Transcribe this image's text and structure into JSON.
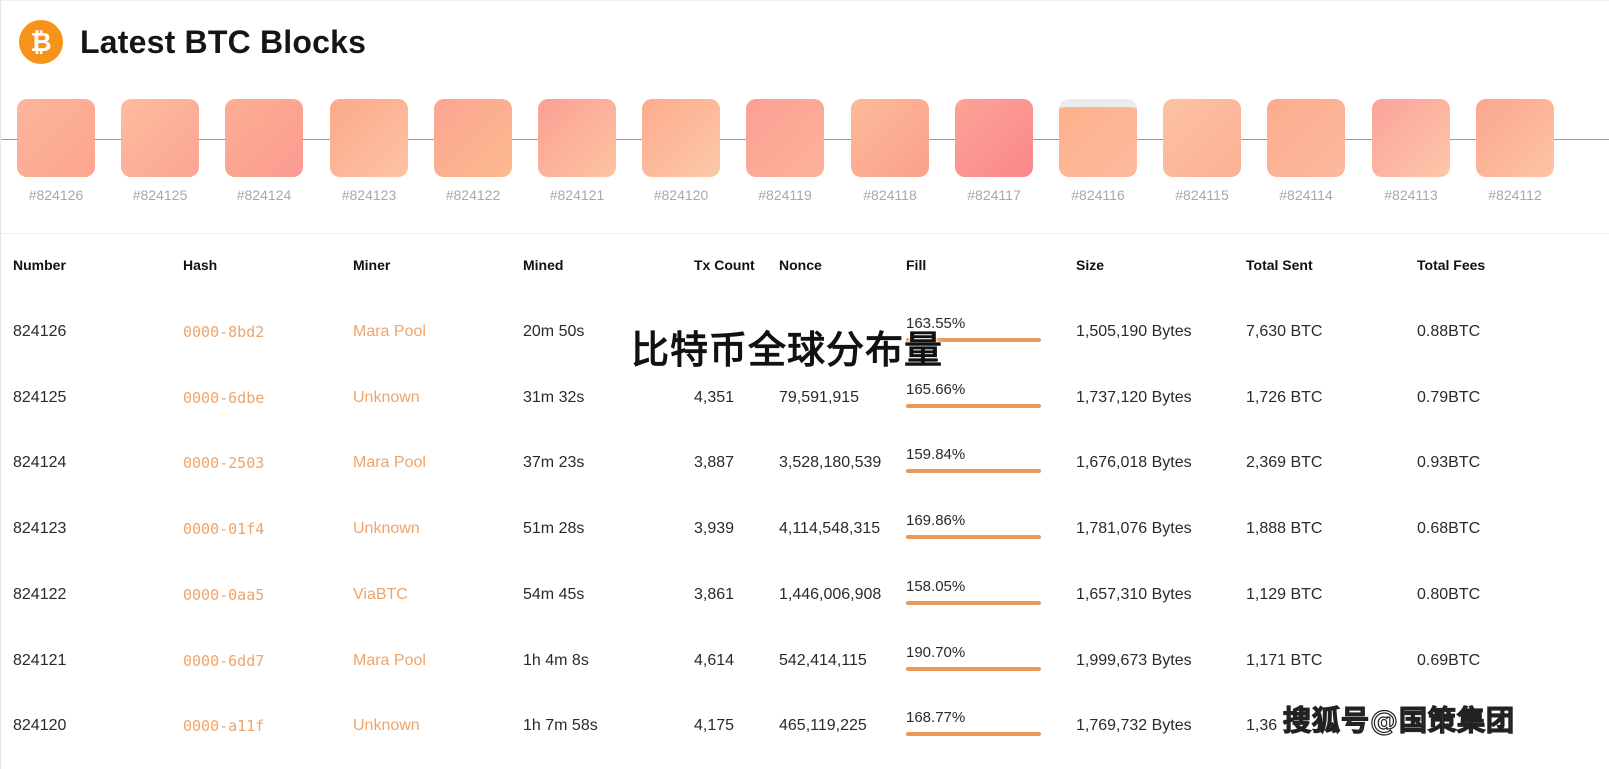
{
  "header": {
    "logo_glyph": "₿",
    "title": "Latest BTC Blocks"
  },
  "blocks": [
    {
      "label": "#824126",
      "color_a": "#fcb59b",
      "color_b": "#fda58f"
    },
    {
      "label": "#824125",
      "color_a": "#fdbc9f",
      "color_b": "#fca493"
    },
    {
      "label": "#824124",
      "color_a": "#fcae93",
      "color_b": "#fb9b92"
    },
    {
      "label": "#824123",
      "color_a": "#fca98a",
      "color_b": "#fdc3a4"
    },
    {
      "label": "#824122",
      "color_a": "#fba593",
      "color_b": "#fdb98c"
    },
    {
      "label": "#824121",
      "color_a": "#fb9f95",
      "color_b": "#fdc4a0"
    },
    {
      "label": "#824120",
      "color_a": "#fdab8c",
      "color_b": "#fcc9aa"
    },
    {
      "label": "#824119",
      "color_a": "#fc9f95",
      "color_b": "#fdb299"
    },
    {
      "label": "#824118",
      "color_a": "#fcba9a",
      "color_b": "#fba08a"
    },
    {
      "label": "#824117",
      "color_a": "#fca397",
      "color_b": "#fb878a"
    },
    {
      "label": "#824116",
      "color_a": "#fdb08c",
      "color_b": "#fdbb9e"
    },
    {
      "label": "#824115",
      "color_a": "#fdc2a1",
      "color_b": "#fcb094"
    },
    {
      "label": "#824114",
      "color_a": "#fcac8d",
      "color_b": "#fcb89f"
    },
    {
      "label": "#824113",
      "color_a": "#fba29a",
      "color_b": "#fdc7aa"
    },
    {
      "label": "#824112",
      "color_a": "#fca68d",
      "color_b": "#fcc4a5"
    }
  ],
  "table": {
    "headers": [
      "Number",
      "Hash",
      "Miner",
      "Mined",
      "Tx Count",
      "Nonce",
      "Fill",
      "Size",
      "Total Sent",
      "Total Fees"
    ],
    "rows": [
      {
        "number": "824126",
        "hash": "0000-8bd2",
        "miner": "Mara Pool",
        "mined": "20m 50s",
        "tx_count": "",
        "nonce": "",
        "fill": "163.55%",
        "fill_value": 1.0,
        "size": "1,505,190 Bytes",
        "total_sent": "7,630 BTC",
        "total_fees": "0.88BTC"
      },
      {
        "number": "824125",
        "hash": "0000-6dbe",
        "miner": "Unknown",
        "mined": "31m 32s",
        "tx_count": "4,351",
        "nonce": "79,591,915",
        "fill": "165.66%",
        "fill_value": 1.0,
        "size": "1,737,120 Bytes",
        "total_sent": "1,726 BTC",
        "total_fees": "0.79BTC"
      },
      {
        "number": "824124",
        "hash": "0000-2503",
        "miner": "Mara Pool",
        "mined": "37m 23s",
        "tx_count": "3,887",
        "nonce": "3,528,180,539",
        "fill": "159.84%",
        "fill_value": 1.0,
        "size": "1,676,018 Bytes",
        "total_sent": "2,369 BTC",
        "total_fees": "0.93BTC"
      },
      {
        "number": "824123",
        "hash": "0000-01f4",
        "miner": "Unknown",
        "mined": "51m 28s",
        "tx_count": "3,939",
        "nonce": "4,114,548,315",
        "fill": "169.86%",
        "fill_value": 1.0,
        "size": "1,781,076 Bytes",
        "total_sent": "1,888 BTC",
        "total_fees": "0.68BTC"
      },
      {
        "number": "824122",
        "hash": "0000-0aa5",
        "miner": "ViaBTC",
        "mined": "54m 45s",
        "tx_count": "3,861",
        "nonce": "1,446,006,908",
        "fill": "158.05%",
        "fill_value": 1.0,
        "size": "1,657,310 Bytes",
        "total_sent": "1,129 BTC",
        "total_fees": "0.80BTC"
      },
      {
        "number": "824121",
        "hash": "0000-6dd7",
        "miner": "Mara Pool",
        "mined": "1h 4m 8s",
        "tx_count": "4,614",
        "nonce": "542,414,115",
        "fill": "190.70%",
        "fill_value": 1.0,
        "size": "1,999,673 Bytes",
        "total_sent": "1,171 BTC",
        "total_fees": "0.69BTC"
      },
      {
        "number": "824120",
        "hash": "0000-a11f",
        "miner": "Unknown",
        "mined": "1h 7m 58s",
        "tx_count": "4,175",
        "nonce": "465,119,225",
        "fill": "168.77%",
        "fill_value": 1.0,
        "size": "1,769,732 Bytes",
        "total_sent": "1,36",
        "total_fees": ""
      }
    ]
  },
  "overlay": {
    "caption": "比特币全球分布量",
    "watermark": "搜狐号@国策集团"
  }
}
